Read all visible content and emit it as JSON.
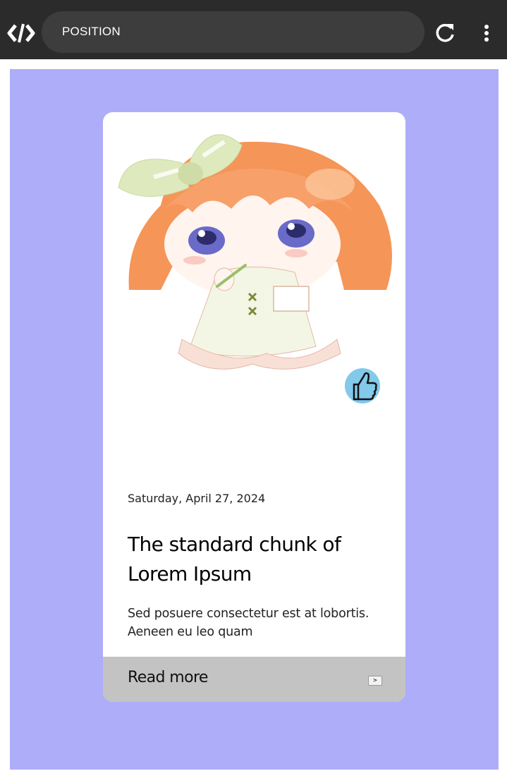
{
  "browser": {
    "url_text": "POSITION",
    "logo_icon": "code-bracket-logo-icon",
    "reload_icon": "reload-icon",
    "menu_icon": "more-vert-icon"
  },
  "page": {
    "background_color": "#adadfa"
  },
  "card": {
    "image_alt": "chibi girl with orange hair and green bow",
    "like_icon": "thumbs-up-icon",
    "date": "Saturday, April 27, 2024",
    "title": "The standard chunk of Lorem Ipsum",
    "description": "Sed posuere consectetur est at lobortis. Aeneen eu leo quam",
    "read_more_label": "Read more",
    "arrow_label": ">"
  }
}
